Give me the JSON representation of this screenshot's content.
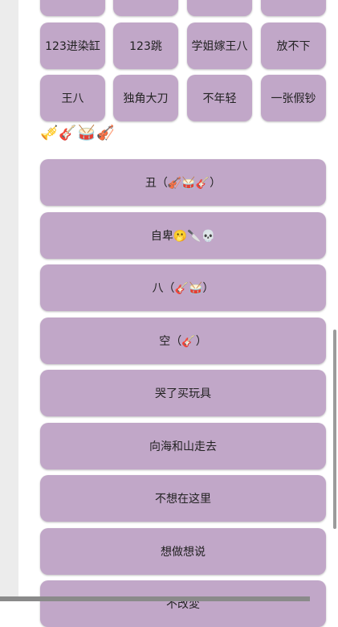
{
  "tiles_row0": [
    "",
    "",
    "",
    ""
  ],
  "tiles_row1": [
    "123进染缸",
    "123跳",
    "学姐嫁王八",
    "放不下"
  ],
  "tiles_row2": [
    "王八",
    "独角大刀",
    "不年轻",
    "一张假钞"
  ],
  "emoji_line": "🎺🎸🥁🎻",
  "songs": [
    "丑（🎻🥁🎸）",
    "自卑🫢🔪💀",
    "八（🎸🥁）",
    "空（🎸）",
    "哭了买玩具",
    "向海和山走去",
    "不想在这里",
    "想做想说",
    "不改変"
  ],
  "colors": {
    "tile": "#c1a7c8",
    "gutter": "#ececec"
  }
}
